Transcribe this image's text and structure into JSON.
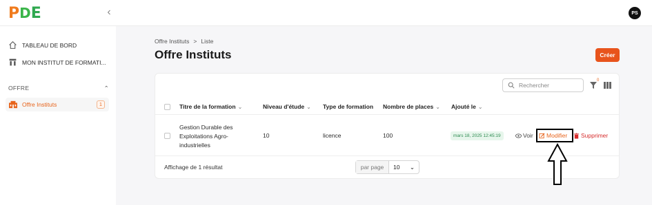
{
  "header": {
    "logo_parts": [
      "P",
      "D",
      "E"
    ],
    "avatar_initials": "PS",
    "collapse_icon": "chevron-left-icon"
  },
  "sidebar": {
    "items": [
      {
        "label": "TABLEAU DE BORD",
        "icon": "home-icon"
      },
      {
        "label": "MON INSTITUT DE FORMATI...",
        "icon": "institution-icon"
      }
    ],
    "section": {
      "label": "OFFRE",
      "toggle_icon": "chevron-up-icon"
    },
    "active_item": {
      "label": "Offre Instituts",
      "badge": "1",
      "icon": "school-icon"
    }
  },
  "breadcrumb": {
    "root": "Offre Instituts",
    "separator": ">",
    "current": "Liste"
  },
  "page": {
    "title": "Offre Instituts",
    "create_label": "Créer"
  },
  "toolbar": {
    "search_placeholder": "Rechercher",
    "filter_count": "0"
  },
  "table": {
    "headers": [
      "Titre de la formation",
      "Niveau d'étude",
      "Type de formation",
      "Nombre de places",
      "Ajouté le"
    ],
    "rows": [
      {
        "title": "Gestion Durable des Exploitations Agro-industrielles",
        "niveau": "10",
        "type": "licence",
        "places": "100",
        "date": "mars 18, 2025 12:45:19",
        "actions": {
          "view": "Voir",
          "edit": "Modifier",
          "delete": "Supprimer"
        }
      }
    ]
  },
  "footer": {
    "summary": "Affichage de 1 résultat",
    "per_page_label": "par page",
    "per_page_value": "10"
  },
  "colors": {
    "accent": "#e8541c",
    "success": "#2c8a4f",
    "danger": "#d62b2b"
  }
}
